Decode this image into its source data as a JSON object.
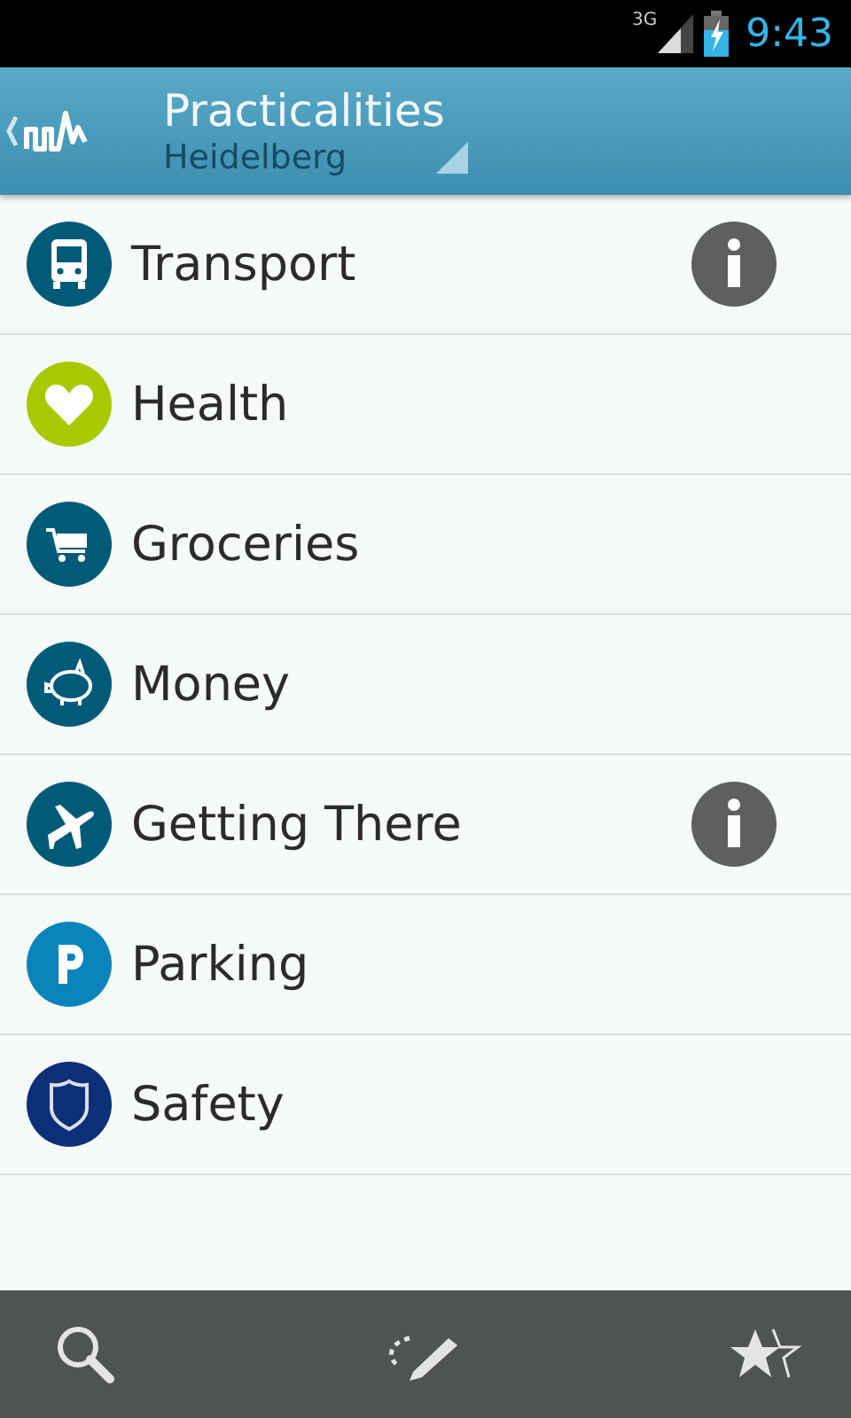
{
  "status_bar": {
    "network": "3G",
    "time": "9:43"
  },
  "header": {
    "title": "Practicalities",
    "subtitle": "Heidelberg"
  },
  "items": [
    {
      "label": "Transport",
      "kind": "bus",
      "color": "#005a78",
      "info": true
    },
    {
      "label": "Health",
      "kind": "heart",
      "color": "#a8c800",
      "info": false
    },
    {
      "label": "Groceries",
      "kind": "cart",
      "color": "#005a78",
      "info": false
    },
    {
      "label": "Money",
      "kind": "piggy",
      "color": "#005a78",
      "info": false
    },
    {
      "label": "Getting There",
      "kind": "plane",
      "color": "#005a78",
      "info": true
    },
    {
      "label": "Parking",
      "kind": "parking",
      "color": "#0a84bb",
      "info": false
    },
    {
      "label": "Safety",
      "kind": "shield",
      "color": "#0c2f78",
      "info": false
    }
  ]
}
